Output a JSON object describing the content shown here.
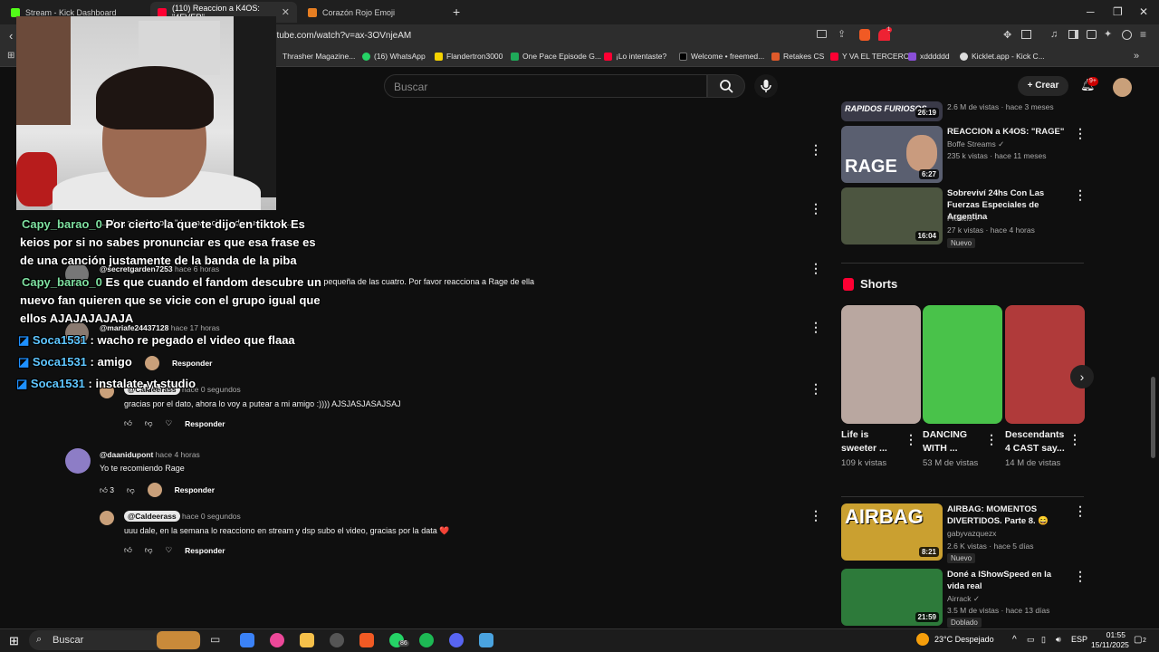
{
  "tabs": [
    {
      "title": "Stream - Kick Dashboard",
      "color": "#53fc18"
    },
    {
      "title": "(110) Reaccion a K4OS: \"4EVER\"",
      "color": "#ff0033"
    },
    {
      "title": "Corazón Rojo Emoji",
      "color": "#e67e22"
    }
  ],
  "address": {
    "url": "utube.com/watch?v=ax-3OVnjeAM",
    "notif_count": "1"
  },
  "bookmarks": [
    "Thrasher Magazine...",
    "(16) WhatsApp",
    "Flandertron3000",
    "One Pace Episode G...",
    "¡Lo intentaste?",
    "Welcome • freemed...",
    "Retakes CS",
    "Y VA EL TERCERO",
    "xdddddd",
    "Kicklet.app - Kick C..."
  ],
  "header": {
    "search_placeholder": "Buscar",
    "create_label": "Crear",
    "notif_badge": "9+"
  },
  "comments": [
    {
      "handle": "@secretgarden7253",
      "time": "hace 6 horas",
      "text": "... pequeña de las cuatro. Por favor reacciona a Rage de ella"
    },
    {
      "handle": "@mariafe24437128",
      "time": "hace 17 horas",
      "text": ""
    },
    {
      "handle": "@Caldeerass",
      "time": "hace 0 segundos",
      "text": "gracias por el dato, ahora lo voy a putear a mi amigo :)))) AJSJASJASAJSAJ",
      "reply": "Responder"
    },
    {
      "handle": "@daanidupont",
      "time": "hace 4 horas",
      "text": "Yo te recomiendo Rage",
      "likes": "3",
      "reply": "Responder"
    },
    {
      "handle": "@Caldeerass",
      "time": "hace 0 segundos",
      "text": "uuu dale, en la semana lo reacciono en stream y dsp subo el video, gracias por la data ❤️",
      "reply": "Responder"
    }
  ],
  "partial": {
    "c0": "...ellas, por ejemplo, \"desaparecimos de vuelta pero...\"",
    "reply": "Responder"
  },
  "chat": [
    {
      "user": "Capy_barao_0",
      "msg": "Por cierto la que te dijo en tiktok Es keios por si no sabes pronunciar  es que esa frase es de una canción justamente de la banda de la piba"
    },
    {
      "user": "Capy_barao_0",
      "msg": "Es que cuando el fandom descubre un nuevo fan quieren que se vicie con el grupo igual que ellos AJAJAJAJAJA"
    },
    {
      "user": "Soca1531",
      "msg": ": wacho re pegado el video que flaaa"
    },
    {
      "user": "Soca1531",
      "msg": ": amigo"
    },
    {
      "user": "Soca1531",
      "msg": ": instalate yt studio"
    }
  ],
  "sidebar": {
    "videos": [
      {
        "title": "",
        "meta": "2.6 M de vistas · hace 3 meses",
        "duration": "26:19",
        "thumb_text": "RAPIDOS FURIOSOS",
        "thumb_color": "#3a3a48"
      },
      {
        "title": "REACCION a K4OS: \"RAGE\"",
        "channel": "Boffe Streams",
        "meta": "235 k vistas · hace 11 meses",
        "duration": "6:27",
        "thumb_text": "RAGE",
        "thumb_color": "#5a5f70"
      },
      {
        "title": "Sobreviví 24hs Con Las Fuerzas Especiales de Argentina",
        "channel": "Francis",
        "meta": "27 k vistas · hace 4 horas",
        "duration": "16:04",
        "badge": "Nuevo",
        "thumb_color": "#4c5540"
      }
    ],
    "shorts_label": "Shorts",
    "shorts": [
      {
        "title": "Life is sweeter ...",
        "views": "109 k vistas",
        "color": "#b9a7a0"
      },
      {
        "title": "DANCING WITH ...",
        "views": "53 M de vistas",
        "color": "#49c24a"
      },
      {
        "title": "Descendants 4 CAST say...",
        "views": "14 M de vistas",
        "color": "#b03a3a"
      }
    ],
    "videos2": [
      {
        "title": "AIRBAG: MOMENTOS DIVERTIDOS. Parte 8. 😄",
        "channel": "gabyvazquezx",
        "meta": "2.6 K vistas · hace 5 días",
        "duration": "8:21",
        "badge": "Nuevo",
        "thumb_text": "AIRBAG",
        "thumb_color": "#caa030"
      },
      {
        "title": "Doné a IShowSpeed en la vida real",
        "channel": "Airrack",
        "meta": "3.5 M de vistas · hace 13 días",
        "duration": "21:59",
        "badge": "Doblado",
        "thumb_color": "#2d7a3a"
      }
    ]
  },
  "taskbar": {
    "search": "Buscar",
    "weather": "23°C  Despejado",
    "lang": "ESP",
    "time": "01:55",
    "date": "15/11/2025",
    "whatsapp_count": "86",
    "notif": "2"
  }
}
